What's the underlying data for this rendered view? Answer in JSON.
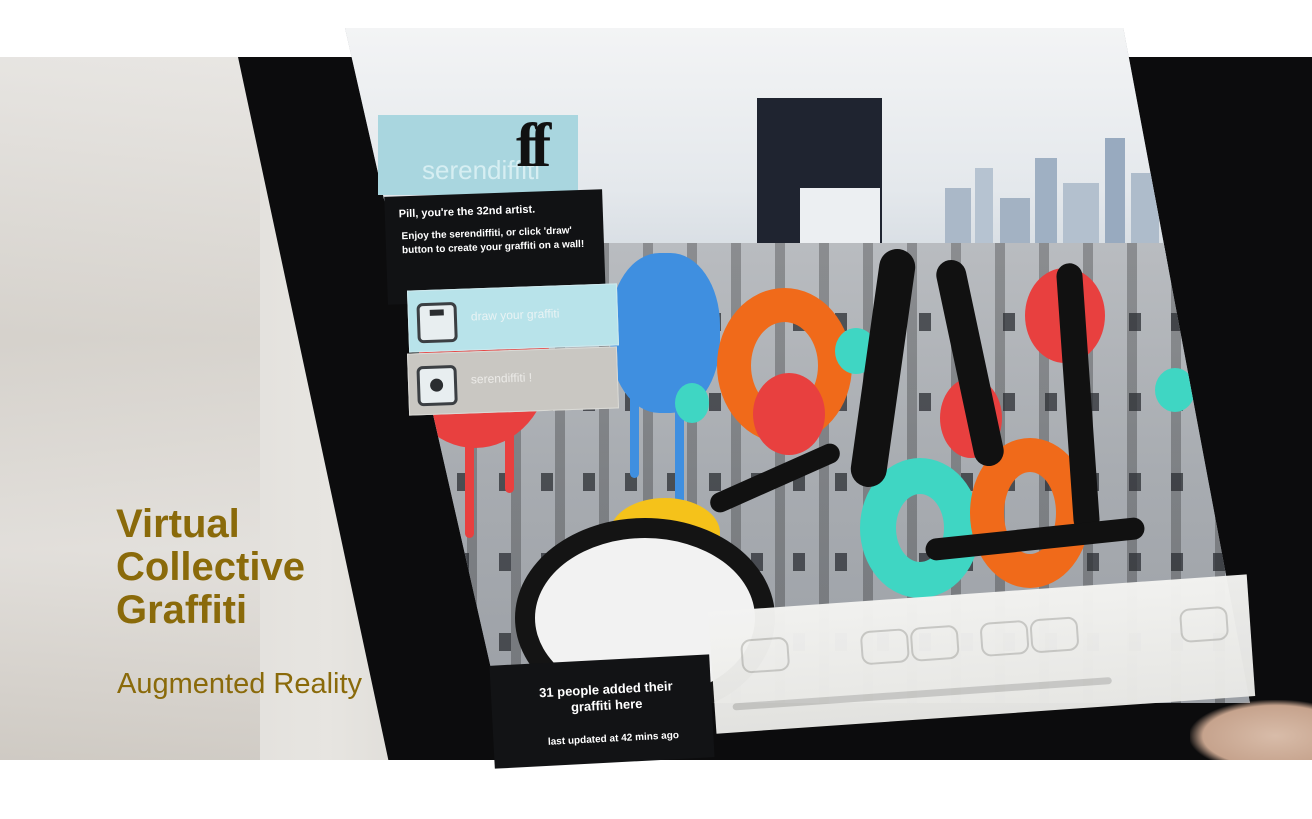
{
  "app": {
    "logo_text": "serendiffiti",
    "logo_mark": "ff",
    "greeting": "Pill, you're the 32nd artist.",
    "instructions": "Enjoy the serendiffiti, or click 'draw' button to create your graffiti on a wall!",
    "option_draw_label": "draw your graffiti",
    "option_serendiffiti_label": "serendiffiti !",
    "option_draw_icon": "pen-icon",
    "option_serendiffiti_icon": "record-icon"
  },
  "counter": {
    "count_text": "31 people added their graffiti here",
    "updated_text": "last updated at 42 mins ago"
  },
  "overlay": {
    "title_line1": "Virtual",
    "title_line2": "Collective",
    "title_line3": "Graffiti",
    "subtitle": "Augmented Reality",
    "text_color": "#8a6a0a"
  },
  "colors": {
    "red": "#e8403f",
    "orange": "#f06a1a",
    "blue": "#3f8fe0",
    "mint": "#3fd6c3",
    "yellow": "#f5c21a",
    "panel_blue": "#a9d6df"
  }
}
